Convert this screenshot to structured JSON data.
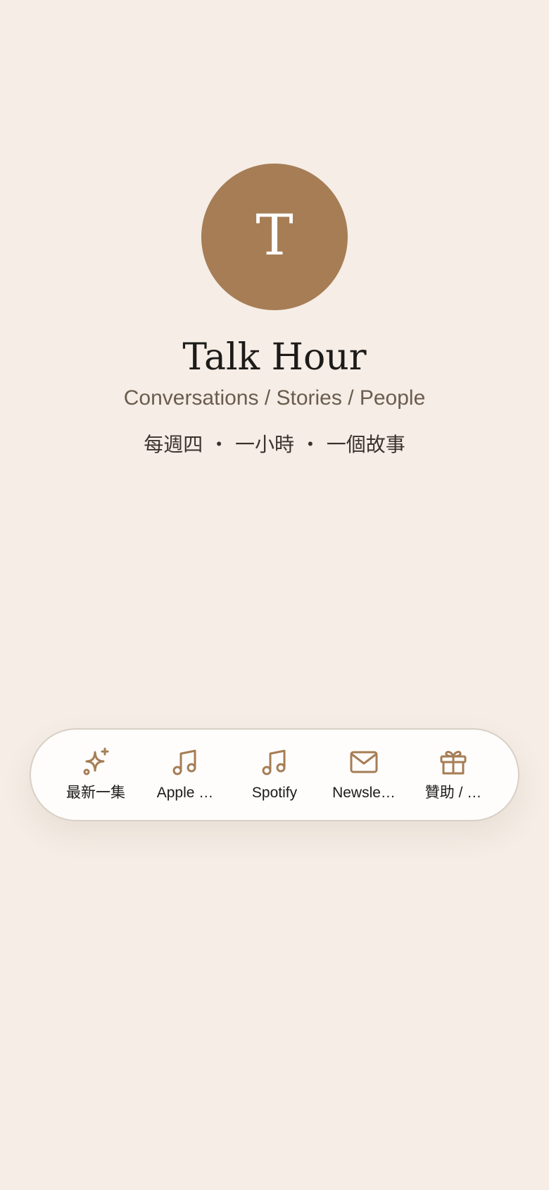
{
  "profile": {
    "avatar_letter": "T",
    "title": "Talk Hour",
    "subtitle": "Conversations / Stories / People",
    "tagline": "每週四 ・ 一小時 ・ 一個故事"
  },
  "colors": {
    "background": "#f5ede6",
    "accent": "#a67d55",
    "dock_background": "#fefdfc"
  },
  "dock": {
    "items": [
      {
        "label": "最新一集",
        "icon": "sparkles-icon"
      },
      {
        "label": "Apple …",
        "icon": "music-note-icon"
      },
      {
        "label": "Spotify",
        "icon": "music-note-icon"
      },
      {
        "label": "Newsle…",
        "icon": "mail-icon"
      },
      {
        "label": "贊助 / …",
        "icon": "gift-icon"
      }
    ]
  }
}
